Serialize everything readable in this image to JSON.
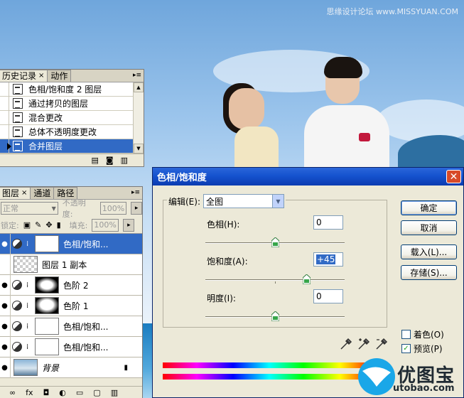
{
  "watermark": "思缘设计论坛 www.MISSYUAN.COM",
  "history_panel": {
    "tabs": [
      {
        "label": "历史记录",
        "close": "×"
      },
      {
        "label": "动作"
      }
    ],
    "items": [
      {
        "label": "色相/饱和度 2 图层"
      },
      {
        "label": "通过拷贝的图层"
      },
      {
        "label": "混合更改"
      },
      {
        "label": "总体不透明度更改"
      },
      {
        "label": "合并图层"
      }
    ]
  },
  "layers_panel": {
    "tabs": [
      {
        "label": "图层",
        "close": "×"
      },
      {
        "label": "通道"
      },
      {
        "label": "路径"
      }
    ],
    "blend_mode": "正常",
    "opacity_label": "不透明度:",
    "opacity_value": "100%",
    "lock_label": "锁定:",
    "fill_label": "填充:",
    "fill_value": "100%",
    "layers": [
      {
        "name": "色相/饱和..."
      },
      {
        "name": "图层 1 副本"
      },
      {
        "name": "色阶 2"
      },
      {
        "name": "色阶 1"
      },
      {
        "name": "色相/饱和..."
      },
      {
        "name": "色相/饱和..."
      },
      {
        "name": "背景"
      }
    ]
  },
  "dialog": {
    "title": "色相/饱和度",
    "edit_label": "编辑(E):",
    "edit_value": "全图",
    "hue_label": "色相(H):",
    "hue_value": "0",
    "saturation_label": "饱和度(A):",
    "saturation_value": "+45",
    "lightness_label": "明度(I):",
    "lightness_value": "0",
    "buttons": {
      "ok": "确定",
      "cancel": "取消",
      "load": "载入(L)...",
      "save": "存储(S)..."
    },
    "colorize_label": "着色(O)",
    "preview_label": "预览(P)",
    "preview_checked": "✓",
    "slider_positions": {
      "hue": 0.5,
      "saturation": 0.725,
      "lightness": 0.5
    }
  },
  "logo": {
    "text": "优图宝",
    "url": "utobao.com"
  }
}
